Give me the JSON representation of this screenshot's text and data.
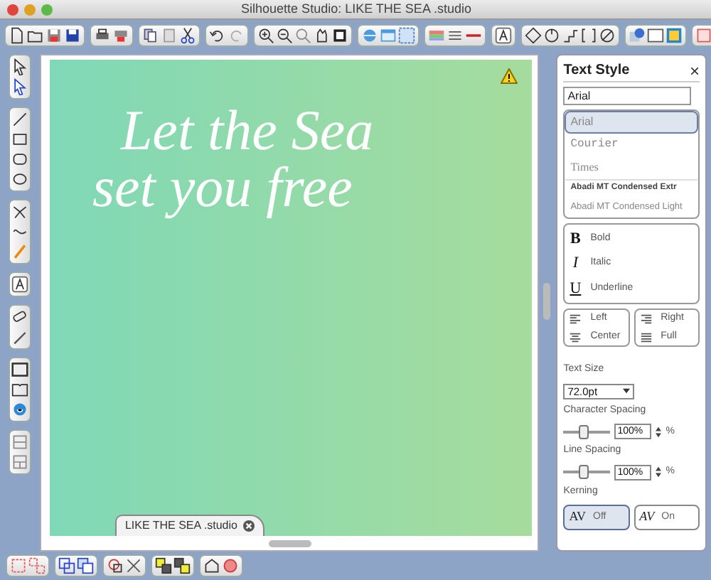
{
  "window": {
    "title": "Silhouette Studio: LIKE THE SEA .studio"
  },
  "canvas": {
    "lines": [
      "Let the Sea",
      "set you free"
    ],
    "warning": true
  },
  "document_tab": {
    "label": "LIKE THE SEA .studio"
  },
  "text_style": {
    "title": "Text Style",
    "close": "×",
    "font_field": "Arial",
    "fonts": [
      {
        "label": "Arial",
        "kind": "sans",
        "selected": true
      },
      {
        "label": "Courier",
        "kind": "mono",
        "selected": false
      },
      {
        "label": "Times",
        "kind": "serif",
        "selected": false
      },
      {
        "label": "Abadi MT Condensed Extr",
        "kind": "bold",
        "selected": false
      },
      {
        "label": "Abadi MT Condensed Light",
        "kind": "light",
        "selected": false
      }
    ],
    "styles": [
      {
        "glyph": "B",
        "label": "Bold",
        "kind": "bold"
      },
      {
        "glyph": "I",
        "label": "Italic",
        "kind": "italic"
      },
      {
        "glyph": "U",
        "label": "Underline",
        "kind": "underline"
      }
    ],
    "alignments": [
      {
        "label": "Left",
        "kind": "left"
      },
      {
        "label": "Right",
        "kind": "right"
      },
      {
        "label": "Center",
        "kind": "center"
      },
      {
        "label": "Full",
        "kind": "full"
      }
    ],
    "text_size": {
      "label": "Text Size",
      "value": "72.0pt"
    },
    "sliders": [
      {
        "label": "Character Spacing",
        "level": 0.45,
        "value": "100%",
        "unit": "%"
      },
      {
        "label": "Line Spacing",
        "level": 0.45,
        "value": "100%",
        "unit": "%"
      }
    ],
    "kerning": {
      "label": "Kerning",
      "options": [
        {
          "glyph": "AV",
          "label": "Off",
          "selected": true
        },
        {
          "glyph": "AV",
          "label": "On",
          "selected": false
        }
      ]
    }
  }
}
